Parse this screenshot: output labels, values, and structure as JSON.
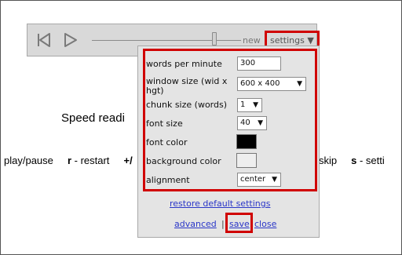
{
  "player": {
    "new_label": "new",
    "settings_label": "settings ▼",
    "slider_position": 0.82
  },
  "page": {
    "title": "Speed readi",
    "shortcuts_left": [
      {
        "key": "",
        "text": "play/pause"
      },
      {
        "key": "r",
        "text": "- restart"
      },
      {
        "key": "+/",
        "text": ""
      }
    ],
    "shortcuts_right": [
      {
        "key": "",
        "text": "- skip"
      },
      {
        "key": "s",
        "text": "- setti"
      }
    ]
  },
  "settings": {
    "words_per_minute": {
      "label": "words per minute",
      "value": "300"
    },
    "window_size": {
      "label": "window size (wid x hgt)",
      "value": "600 x 400"
    },
    "chunk_size": {
      "label": "chunk size (words)",
      "value": "1"
    },
    "font_size": {
      "label": "font size",
      "value": "40"
    },
    "font_color": {
      "label": "font color",
      "color": "#000000"
    },
    "background_color": {
      "label": "background color",
      "color": "#eeeeee"
    },
    "alignment": {
      "label": "alignment",
      "value": "center"
    },
    "restore_label": "restore default settings",
    "advanced_label": "advanced",
    "save_label": "save",
    "close_label": "close"
  },
  "colors": {
    "highlight": "#d00000",
    "link": "#2a36c8",
    "panel_bg": "#e4e4e4",
    "toolbar_bg": "#d9d9d9"
  }
}
